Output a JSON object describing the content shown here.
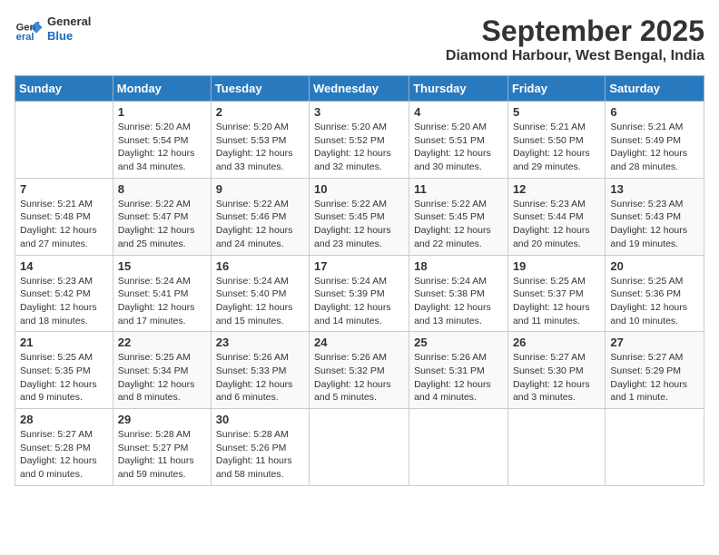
{
  "header": {
    "logo_general": "General",
    "logo_blue": "Blue",
    "title": "September 2025",
    "location": "Diamond Harbour, West Bengal, India"
  },
  "days_header": [
    "Sunday",
    "Monday",
    "Tuesday",
    "Wednesday",
    "Thursday",
    "Friday",
    "Saturday"
  ],
  "weeks": [
    [
      {
        "num": "",
        "info": ""
      },
      {
        "num": "1",
        "info": "Sunrise: 5:20 AM\nSunset: 5:54 PM\nDaylight: 12 hours\nand 34 minutes."
      },
      {
        "num": "2",
        "info": "Sunrise: 5:20 AM\nSunset: 5:53 PM\nDaylight: 12 hours\nand 33 minutes."
      },
      {
        "num": "3",
        "info": "Sunrise: 5:20 AM\nSunset: 5:52 PM\nDaylight: 12 hours\nand 32 minutes."
      },
      {
        "num": "4",
        "info": "Sunrise: 5:20 AM\nSunset: 5:51 PM\nDaylight: 12 hours\nand 30 minutes."
      },
      {
        "num": "5",
        "info": "Sunrise: 5:21 AM\nSunset: 5:50 PM\nDaylight: 12 hours\nand 29 minutes."
      },
      {
        "num": "6",
        "info": "Sunrise: 5:21 AM\nSunset: 5:49 PM\nDaylight: 12 hours\nand 28 minutes."
      }
    ],
    [
      {
        "num": "7",
        "info": "Sunrise: 5:21 AM\nSunset: 5:48 PM\nDaylight: 12 hours\nand 27 minutes."
      },
      {
        "num": "8",
        "info": "Sunrise: 5:22 AM\nSunset: 5:47 PM\nDaylight: 12 hours\nand 25 minutes."
      },
      {
        "num": "9",
        "info": "Sunrise: 5:22 AM\nSunset: 5:46 PM\nDaylight: 12 hours\nand 24 minutes."
      },
      {
        "num": "10",
        "info": "Sunrise: 5:22 AM\nSunset: 5:45 PM\nDaylight: 12 hours\nand 23 minutes."
      },
      {
        "num": "11",
        "info": "Sunrise: 5:22 AM\nSunset: 5:45 PM\nDaylight: 12 hours\nand 22 minutes."
      },
      {
        "num": "12",
        "info": "Sunrise: 5:23 AM\nSunset: 5:44 PM\nDaylight: 12 hours\nand 20 minutes."
      },
      {
        "num": "13",
        "info": "Sunrise: 5:23 AM\nSunset: 5:43 PM\nDaylight: 12 hours\nand 19 minutes."
      }
    ],
    [
      {
        "num": "14",
        "info": "Sunrise: 5:23 AM\nSunset: 5:42 PM\nDaylight: 12 hours\nand 18 minutes."
      },
      {
        "num": "15",
        "info": "Sunrise: 5:24 AM\nSunset: 5:41 PM\nDaylight: 12 hours\nand 17 minutes."
      },
      {
        "num": "16",
        "info": "Sunrise: 5:24 AM\nSunset: 5:40 PM\nDaylight: 12 hours\nand 15 minutes."
      },
      {
        "num": "17",
        "info": "Sunrise: 5:24 AM\nSunset: 5:39 PM\nDaylight: 12 hours\nand 14 minutes."
      },
      {
        "num": "18",
        "info": "Sunrise: 5:24 AM\nSunset: 5:38 PM\nDaylight: 12 hours\nand 13 minutes."
      },
      {
        "num": "19",
        "info": "Sunrise: 5:25 AM\nSunset: 5:37 PM\nDaylight: 12 hours\nand 11 minutes."
      },
      {
        "num": "20",
        "info": "Sunrise: 5:25 AM\nSunset: 5:36 PM\nDaylight: 12 hours\nand 10 minutes."
      }
    ],
    [
      {
        "num": "21",
        "info": "Sunrise: 5:25 AM\nSunset: 5:35 PM\nDaylight: 12 hours\nand 9 minutes."
      },
      {
        "num": "22",
        "info": "Sunrise: 5:25 AM\nSunset: 5:34 PM\nDaylight: 12 hours\nand 8 minutes."
      },
      {
        "num": "23",
        "info": "Sunrise: 5:26 AM\nSunset: 5:33 PM\nDaylight: 12 hours\nand 6 minutes."
      },
      {
        "num": "24",
        "info": "Sunrise: 5:26 AM\nSunset: 5:32 PM\nDaylight: 12 hours\nand 5 minutes."
      },
      {
        "num": "25",
        "info": "Sunrise: 5:26 AM\nSunset: 5:31 PM\nDaylight: 12 hours\nand 4 minutes."
      },
      {
        "num": "26",
        "info": "Sunrise: 5:27 AM\nSunset: 5:30 PM\nDaylight: 12 hours\nand 3 minutes."
      },
      {
        "num": "27",
        "info": "Sunrise: 5:27 AM\nSunset: 5:29 PM\nDaylight: 12 hours\nand 1 minute."
      }
    ],
    [
      {
        "num": "28",
        "info": "Sunrise: 5:27 AM\nSunset: 5:28 PM\nDaylight: 12 hours\nand 0 minutes."
      },
      {
        "num": "29",
        "info": "Sunrise: 5:28 AM\nSunset: 5:27 PM\nDaylight: 11 hours\nand 59 minutes."
      },
      {
        "num": "30",
        "info": "Sunrise: 5:28 AM\nSunset: 5:26 PM\nDaylight: 11 hours\nand 58 minutes."
      },
      {
        "num": "",
        "info": ""
      },
      {
        "num": "",
        "info": ""
      },
      {
        "num": "",
        "info": ""
      },
      {
        "num": "",
        "info": ""
      }
    ]
  ]
}
